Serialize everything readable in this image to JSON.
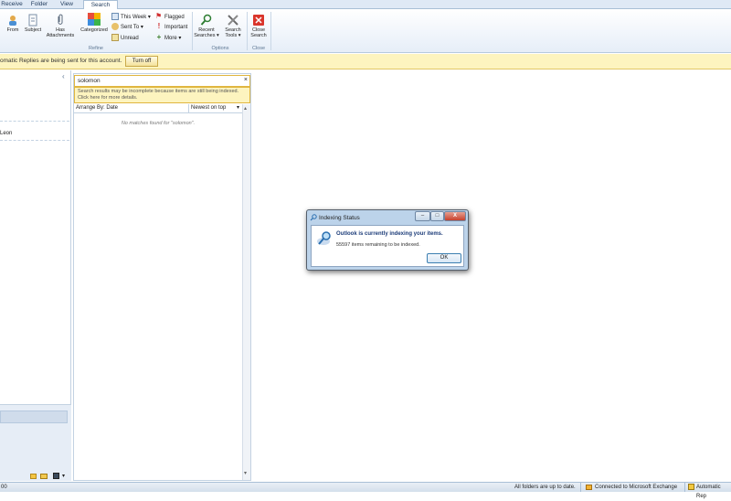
{
  "tabs": [
    "Receive",
    "Folder",
    "View",
    "Search"
  ],
  "ribbon": {
    "from": "From",
    "subject": "Subject",
    "has_attachments": "Has Attachments",
    "categorized": "Categorized",
    "this_week": "This Week",
    "sent_to": "Sent To",
    "unread": "Unread",
    "flagged": "Flagged",
    "important": "Important",
    "more": "More",
    "recent_searches": "Recent Searches",
    "search_tools": "Search Tools",
    "close_search": "Close Search",
    "group_refine": "Refine",
    "group_options": "Options",
    "group_close": "Close"
  },
  "infobar": {
    "text": "omatic Replies are being sent for this account.",
    "button": "Turn off"
  },
  "nav": {
    "collapse": "‹",
    "item": "Leon"
  },
  "search": {
    "value": "solomon",
    "clear": "×",
    "warning": "Search results may be incomplete because items are still being indexed. Click here for more details.",
    "arrange": "Arrange By: Date",
    "sort": "Newest on top",
    "no_match": "No matches found for \"solomon\"."
  },
  "dialog": {
    "title": "Indexing Status",
    "heading": "Outlook is currently indexing your items.",
    "remaining": "55597 items remaining to be indexed.",
    "ok": "OK",
    "close": "X"
  },
  "status": {
    "left": "00",
    "folders": "All folders are up to date.",
    "connected": "Connected to Microsoft Exchange",
    "automatic": "Automatic Rep"
  }
}
